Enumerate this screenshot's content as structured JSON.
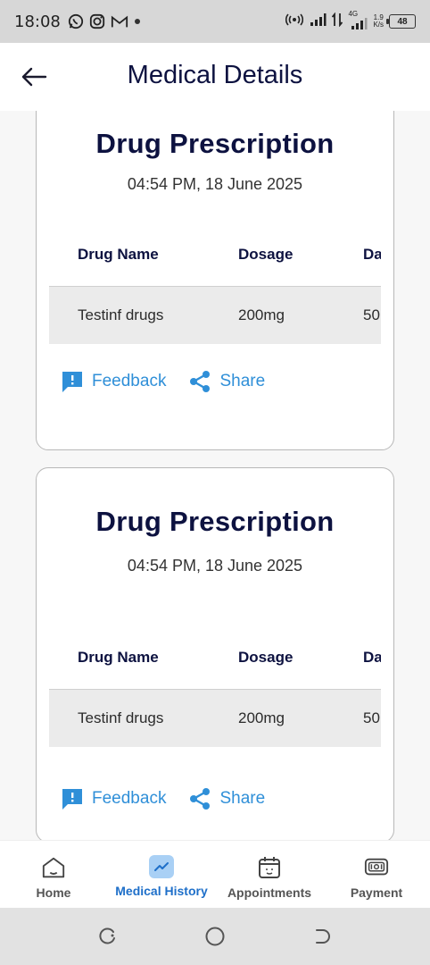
{
  "status_bar": {
    "time": "18:08",
    "network_speed_top": "1.9",
    "network_speed_unit": "K/s",
    "network_type": "4G",
    "battery": "48",
    "icons": [
      "whatsapp-icon",
      "instagram-icon",
      "gmail-icon",
      "dot-icon",
      "hotspot-icon",
      "signal-icon",
      "data-arrows-icon",
      "signal-4g-icon",
      "battery-icon"
    ]
  },
  "header": {
    "title": "Medical Details",
    "back_icon": "back-arrow-icon"
  },
  "prescriptions": [
    {
      "title": "Drug Prescription",
      "date": "04:54 PM, 18 June 2025",
      "columns": [
        "Drug Name",
        "Dosage",
        "Da"
      ],
      "rows": [
        [
          "Testinf drugs",
          "200mg",
          "50"
        ]
      ],
      "feedback_label": "Feedback",
      "share_label": "Share"
    },
    {
      "title": "Drug Prescription",
      "date": "04:54 PM, 18 June 2025",
      "columns": [
        "Drug Name",
        "Dosage",
        "Da"
      ],
      "rows": [
        [
          "Testinf drugs",
          "200mg",
          "50"
        ]
      ],
      "feedback_label": "Feedback",
      "share_label": "Share"
    }
  ],
  "bottom_nav": {
    "items": [
      {
        "label": "Home",
        "icon": "home-icon",
        "active": false
      },
      {
        "label": "Medical History",
        "icon": "chart-icon",
        "active": true
      },
      {
        "label": "Appointments",
        "icon": "calendar-icon",
        "active": false
      },
      {
        "label": "Payment",
        "icon": "payment-icon",
        "active": false
      }
    ]
  },
  "colors": {
    "accent": "#2f8fd8",
    "active_nav": "#1e6fc9",
    "title_navy": "#0d1240",
    "row_bg": "#ebebeb"
  }
}
